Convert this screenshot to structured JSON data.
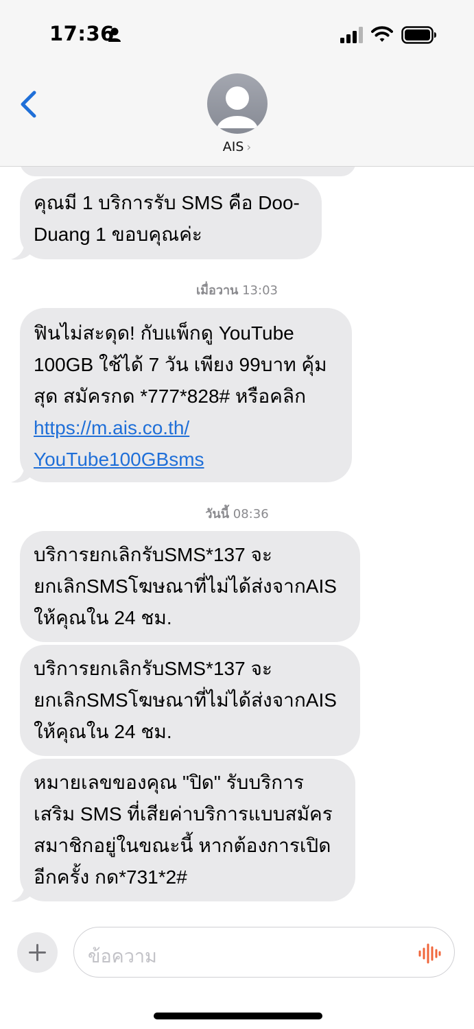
{
  "status_bar": {
    "time": "17:36"
  },
  "header": {
    "contact_name": "AIS",
    "chevron": "›"
  },
  "messages": [
    {
      "lines": [
        "คุณมี 1 บริการรับ SMS คือ Doo-",
        "Duang 1 ขอบคุณค่ะ"
      ]
    },
    {
      "timestamp_day": "เมื่อวาน",
      "timestamp_time": "13:03",
      "lines": [
        "ฟินไม่สะดุด! กับแพ็กดู YouTube",
        "100GB ใช้ได้ 7 วัน เพียง 99บาท คุ้ม",
        "สุด สมัครกด *777*828# หรือคลิก"
      ],
      "link_lines": [
        "https://m.ais.co.th/",
        "YouTube100GBsms"
      ]
    },
    {
      "timestamp_day": "วันนี้",
      "timestamp_time": "08:36",
      "lines": [
        "บริการยกเลิกรับSMS*137 จะ",
        "ยกเลิกSMSโฆษณาที่ไม่ได้ส่งจากAIS",
        "ให้คุณใน 24 ชม."
      ]
    },
    {
      "lines": [
        "บริการยกเลิกรับSMS*137 จะ",
        "ยกเลิกSMSโฆษณาที่ไม่ได้ส่งจากAIS",
        "ให้คุณใน 24 ชม."
      ]
    },
    {
      "lines": [
        "หมายเลขของคุณ \"ปิด\" รับบริการ",
        "เสริม SMS ที่เสียค่าบริการแบบสมัคร",
        "สมาชิกอยู่ในขณะนี้ หากต้องการเปิด",
        "อีกครั้ง กด*731*2#"
      ]
    }
  ],
  "composer": {
    "placeholder": "ข้อความ"
  },
  "icons": {
    "person": "person-icon",
    "signal": "signal-icon",
    "wifi": "wifi-icon",
    "battery": "battery-icon",
    "back": "chevron-left-icon",
    "avatar": "contact-avatar-icon",
    "plus": "plus-icon",
    "voice": "voice-waveform-icon"
  },
  "colors": {
    "accent": "#1f6fd8",
    "bubble": "#e9e9eb",
    "voice": "#f0663b"
  }
}
